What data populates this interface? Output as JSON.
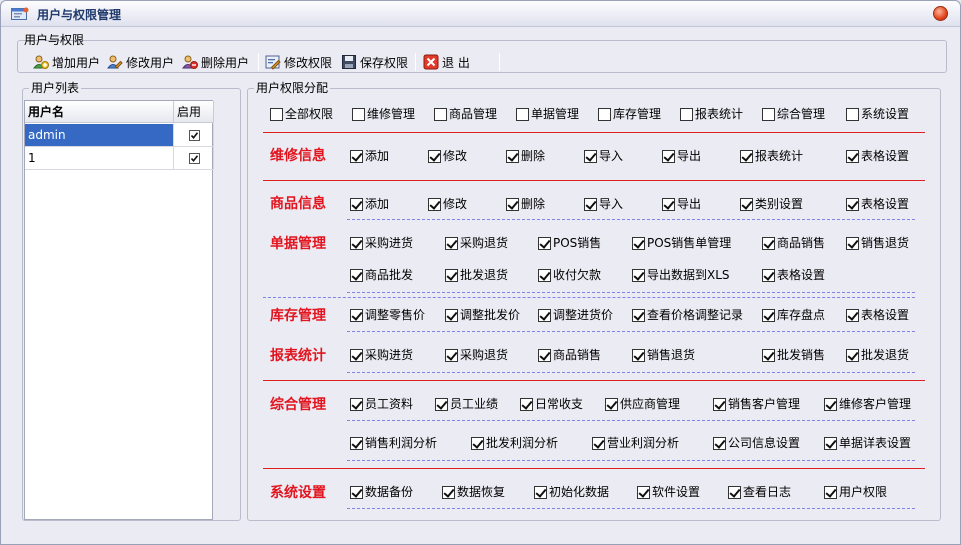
{
  "window": {
    "title": "用户与权限管理"
  },
  "toolbar_group": {
    "legend": "用户与权限",
    "buttons": [
      "增加用户",
      "修改用户",
      "删除用户",
      "修改权限",
      "保存权限",
      "退 出"
    ]
  },
  "user_list": {
    "legend": "用户列表",
    "columns": [
      "用户名",
      "启用"
    ],
    "rows": [
      {
        "name": "admin",
        "enabled": true,
        "selected": true
      },
      {
        "name": "1",
        "enabled": true,
        "selected": false
      }
    ]
  },
  "permissions": {
    "legend": "用户权限分配",
    "top_checks": [
      "全部权限",
      "维修管理",
      "商品管理",
      "单据管理",
      "库存管理",
      "报表统计",
      "综合管理",
      "系统设置"
    ],
    "sections": {
      "repair": {
        "title": "维修信息",
        "items": [
          "添加",
          "修改",
          "删除",
          "导入",
          "导出",
          "报表统计",
          "表格设置"
        ]
      },
      "goods": {
        "title": "商品信息",
        "items": [
          "添加",
          "修改",
          "删除",
          "导入",
          "导出",
          "类别设置",
          "表格设置"
        ]
      },
      "documents": {
        "title": "单据管理",
        "row1": [
          "采购进货",
          "采购退货",
          "POS销售",
          "POS销售单管理",
          "商品销售",
          "销售退货"
        ],
        "row2": [
          "商品批发",
          "批发退货",
          "收付欠款",
          "导出数据到XLS",
          "表格设置"
        ]
      },
      "stock": {
        "title": "库存管理",
        "items": [
          "调整零售价",
          "调整批发价",
          "调整进货价",
          "查看价格调整记录",
          "库存盘点",
          "表格设置"
        ]
      },
      "reports": {
        "title": "报表统计",
        "items": [
          "采购进货",
          "采购退货",
          "商品销售",
          "销售退货",
          "批发销售",
          "批发退货"
        ]
      },
      "general": {
        "title": "综合管理",
        "row1": [
          "员工资料",
          "员工业绩",
          "日常收支",
          "供应商管理",
          "销售客户管理",
          "维修客户管理"
        ],
        "row2": [
          "销售利润分析",
          "批发利润分析",
          "营业利润分析",
          "公司信息设置",
          "单据详表设置"
        ]
      },
      "system": {
        "title": "系统设置",
        "items": [
          "数据备份",
          "数据恢复",
          "初始化数据",
          "软件设置",
          "查看日志",
          "用户权限"
        ]
      }
    }
  }
}
